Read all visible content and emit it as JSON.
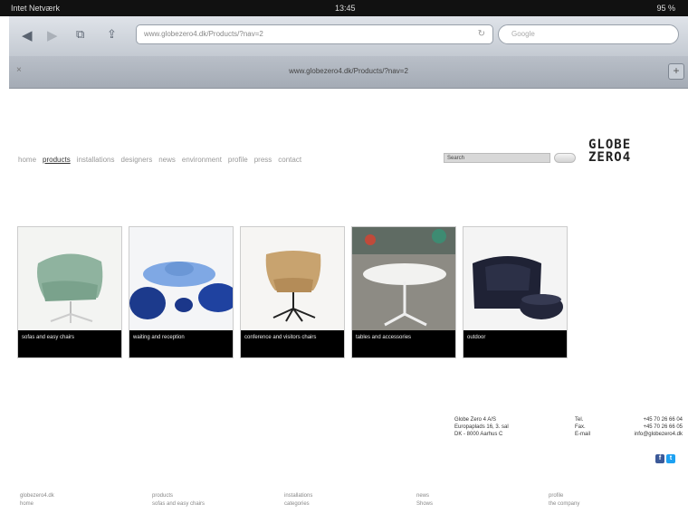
{
  "status_bar": {
    "carrier": "Intet Netværk",
    "time": "13:45",
    "battery": "95 %"
  },
  "browser": {
    "url": "www.globezero4.dk/Products/?nav=2",
    "search_placeholder": "Google",
    "tab_title": "www.globezero4.dk/Products/?nav=2",
    "add_tab_label": "+",
    "close_tab_label": "×"
  },
  "site": {
    "logo_line1": "GLOBE",
    "logo_line2": "ZERO4",
    "nav": [
      "home",
      "products",
      "installations",
      "designers",
      "news",
      "environment",
      "profile",
      "press",
      "contact"
    ],
    "search_value": "Search",
    "products": [
      {
        "label": "sofas and easy chairs"
      },
      {
        "label": "waiting and reception"
      },
      {
        "label": "conference and visitors chairs"
      },
      {
        "label": "tables and accessories"
      },
      {
        "label": "outdoor"
      }
    ],
    "contact": {
      "company": "Globe Zero 4 A/S",
      "street": "Europaplads 16, 3. sal",
      "city": "DK - 8000 Aarhus C",
      "tel_label": "Tel.",
      "fax_label": "Fax.",
      "email_label": "E-mail",
      "tel": "+45 70 26 66 04",
      "fax": "+45 70 26 66 05",
      "email": "info@globezero4.dk"
    },
    "footer": [
      {
        "title": "globezero4.dk",
        "sub": "home"
      },
      {
        "title": "products",
        "sub": "sofas and easy chairs"
      },
      {
        "title": "installations",
        "sub": "categories"
      },
      {
        "title": "news",
        "sub": "Shows"
      },
      {
        "title": "profile",
        "sub": "the company"
      }
    ]
  }
}
